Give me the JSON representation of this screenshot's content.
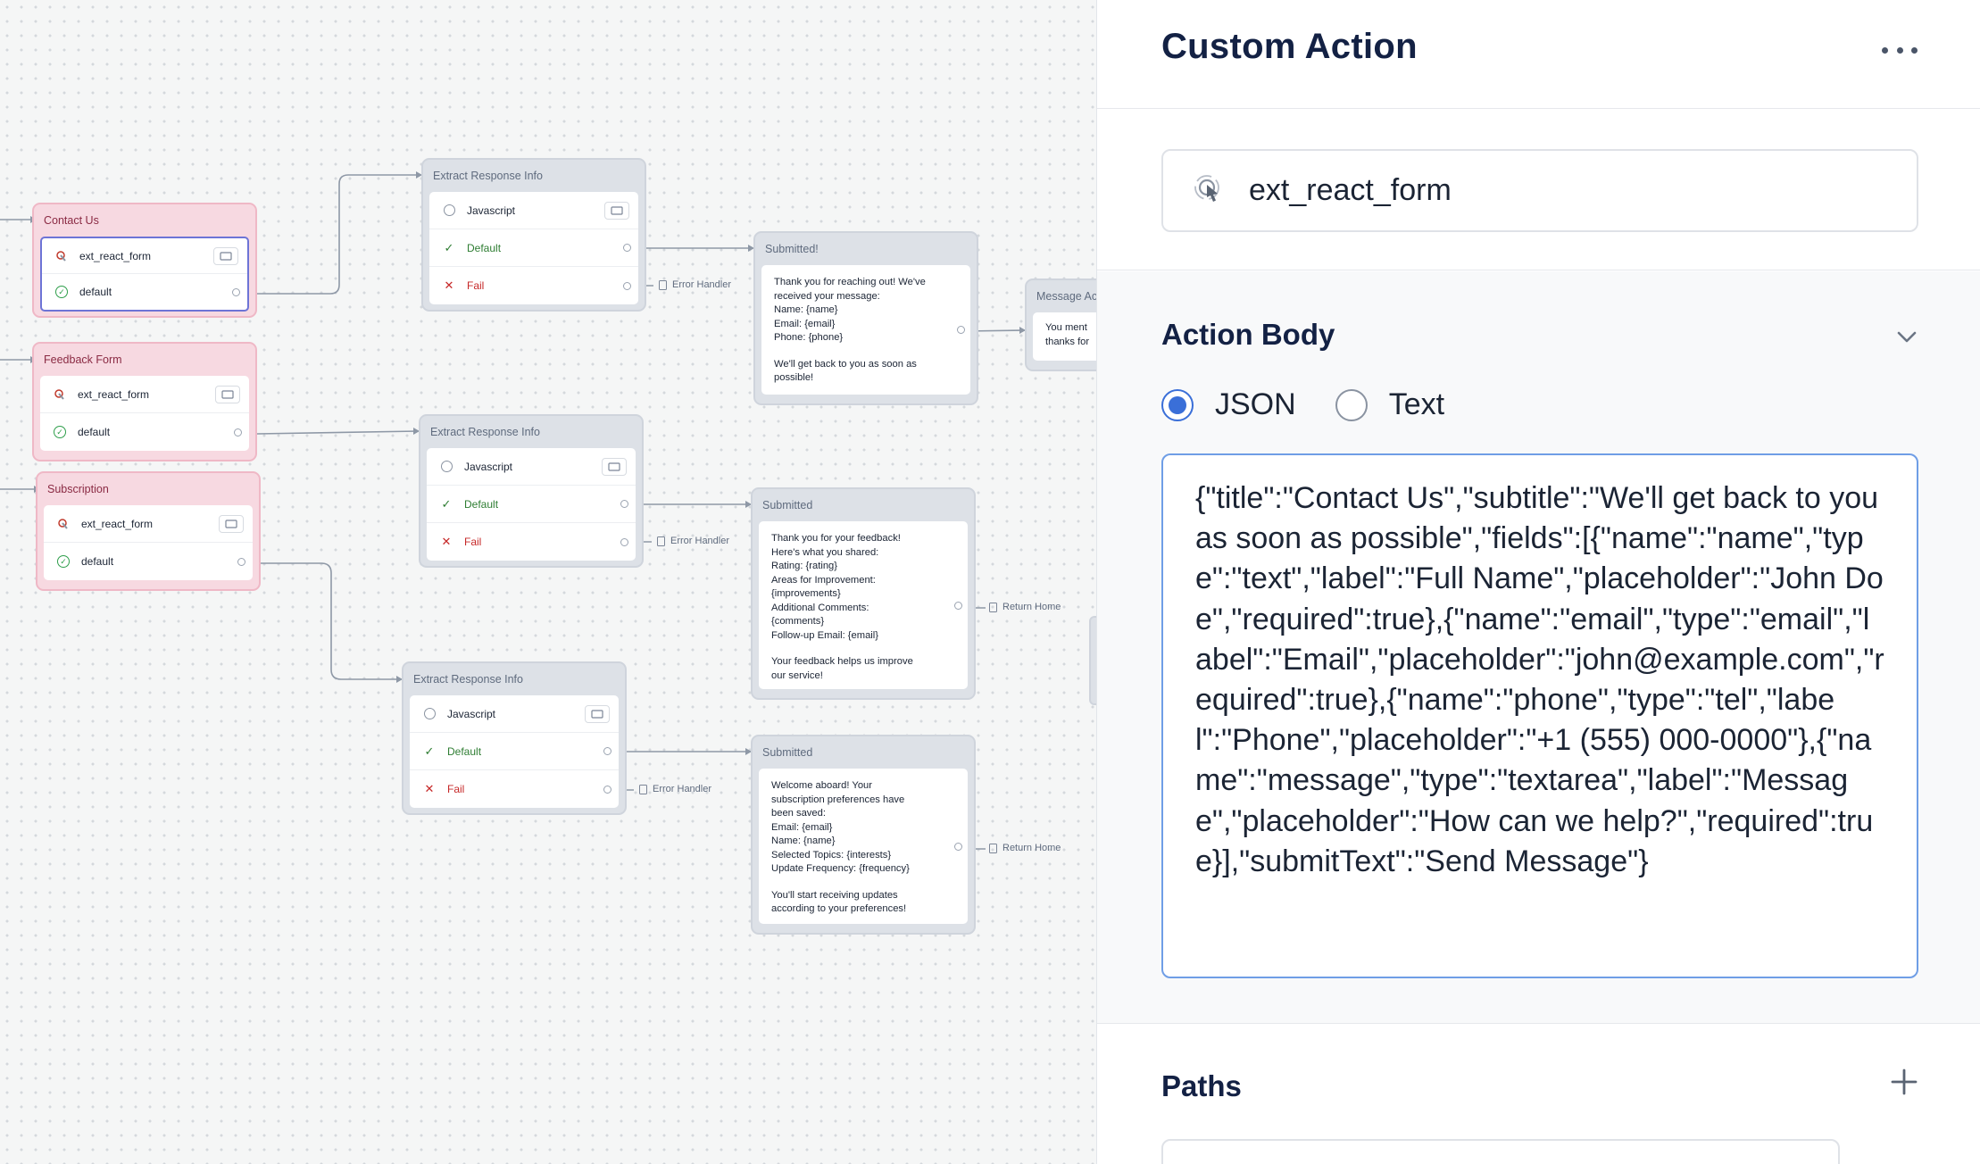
{
  "canvas": {
    "contact_block": {
      "title": "Contact Us",
      "action_label": "ext_react_form",
      "path_label": "default"
    },
    "feedback_block": {
      "title": "Feedback Form",
      "action_label": "ext_react_form",
      "path_label": "default"
    },
    "subscription_block": {
      "title": "Subscription",
      "action_label": "ext_react_form",
      "path_label": "default"
    },
    "extract_1": {
      "title": "Extract Response Info",
      "step": "Javascript",
      "default": "Default",
      "fail": "Fail",
      "error_link": "Error Handler"
    },
    "extract_2": {
      "title": "Extract Response Info",
      "step": "Javascript",
      "default": "Default",
      "fail": "Fail",
      "error_link": "Error Handler"
    },
    "extract_3": {
      "title": "Extract Response Info",
      "step": "Javascript",
      "default": "Default",
      "fail": "Fail",
      "error_link": "Error Handler"
    },
    "submitted_1": {
      "title": "Submitted!",
      "lines": [
        "Thank you for reaching out! We've",
        "received your message:",
        "Name: {name}",
        "Email: {email}",
        "Phone: {phone}"
      ],
      "footer": [
        "We'll get back to you as soon as",
        "possible!"
      ]
    },
    "submitted_2": {
      "title": "Submitted",
      "lines": [
        "Thank you for your feedback!",
        "Here's what you shared:",
        "Rating: {rating}",
        "Areas for Improvement:",
        "{improvements}",
        "Additional Comments:",
        "{comments}",
        "Follow-up Email: {email}"
      ],
      "footer": [
        "Your feedback helps us improve",
        "our service!"
      ],
      "link": "Return Home"
    },
    "submitted_3": {
      "title": "Submitted",
      "lines": [
        "Welcome aboard! Your",
        "subscription preferences have",
        "been saved:",
        "Email: {email}",
        "Name: {name}",
        "Selected Topics: {interests}",
        "Update Frequency: {frequency}"
      ],
      "footer": [
        "You'll start receiving updates",
        "according to your preferences!"
      ],
      "link": "Return Home"
    },
    "message_partial": {
      "title": "Message Ac",
      "lines": [
        "You ment",
        "thanks for"
      ]
    }
  },
  "panel": {
    "title": "Custom Action",
    "action_name": "ext_react_form",
    "action_body_title": "Action Body",
    "radio_json": "JSON",
    "radio_text": "Text",
    "body_text": "{\"title\":\"Contact Us\",\"subtitle\":\"We'll get back to you as soon as possible\",\"fields\":[{\"name\":\"name\",\"type\":\"text\",\"label\":\"Full Name\",\"placeholder\":\"John Doe\",\"required\":true},{\"name\":\"email\",\"type\":\"email\",\"label\":\"Email\",\"placeholder\":\"john@example.com\",\"required\":true},{\"name\":\"phone\",\"type\":\"tel\",\"label\":\"Phone\",\"placeholder\":\"+1 (555) 000-0000\"},{\"name\":\"message\",\"type\":\"textarea\",\"label\":\"Message\",\"placeholder\":\"How can we help?\",\"required\":true}],\"submitText\":\"Send Message\"}",
    "paths_title": "Paths"
  },
  "colors": {
    "accent": "#3a6fd8",
    "pink_block": "#f7d9e1",
    "grey_block": "#dde1e7",
    "default_green": "#2e7d32",
    "fail_red": "#c62828"
  }
}
